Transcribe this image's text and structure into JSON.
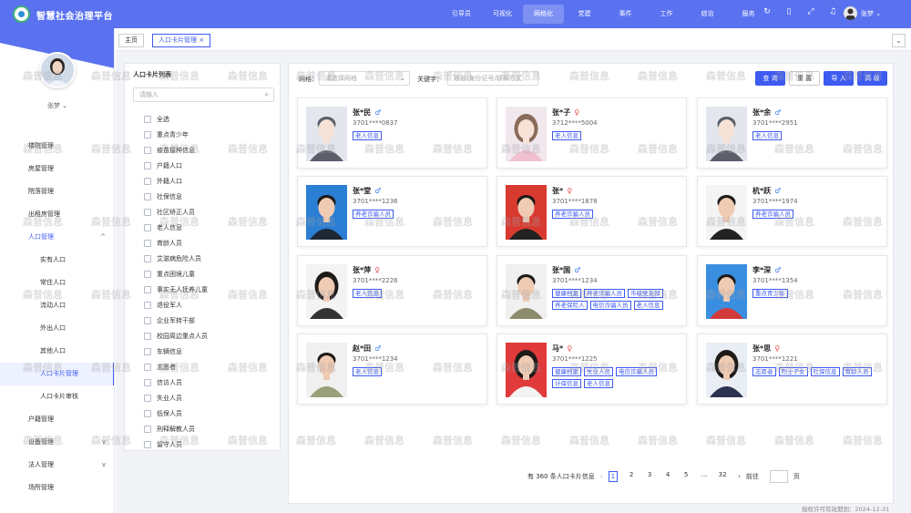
{
  "header": {
    "app_title": "智慧社会治理平台",
    "nav": [
      "引导员",
      "可视化",
      "网格化",
      "党建",
      "事件",
      "工作",
      "综治",
      "服务"
    ],
    "active_nav": "网格化",
    "user": "张梦"
  },
  "sidebar": {
    "user_name": "张梦",
    "items": [
      {
        "label": "楼院管理",
        "sub": false,
        "arrow": ""
      },
      {
        "label": "房屋管理",
        "sub": false,
        "arrow": ""
      },
      {
        "label": "院落管理",
        "sub": false,
        "arrow": ""
      },
      {
        "label": "出租房管理",
        "sub": false,
        "arrow": ""
      },
      {
        "label": "人口管理",
        "sub": false,
        "arrow": "^",
        "blue": true
      },
      {
        "label": "实有人口",
        "sub": true,
        "arrow": ""
      },
      {
        "label": "常住人口",
        "sub": true,
        "arrow": ""
      },
      {
        "label": "流动人口",
        "sub": true,
        "arrow": ""
      },
      {
        "label": "外出人口",
        "sub": true,
        "arrow": ""
      },
      {
        "label": "其他人口",
        "sub": true,
        "arrow": ""
      },
      {
        "label": "人口卡片管理",
        "sub": true,
        "arrow": "",
        "active": true
      },
      {
        "label": "人口卡片审核",
        "sub": true,
        "arrow": ""
      },
      {
        "label": "户籍管理",
        "sub": false,
        "arrow": ""
      },
      {
        "label": "设备管理",
        "sub": false,
        "arrow": "v"
      },
      {
        "label": "法人管理",
        "sub": false,
        "arrow": "v"
      },
      {
        "label": "场所管理",
        "sub": false,
        "arrow": ""
      }
    ]
  },
  "tabs": {
    "home": "主页",
    "current": "人口卡片管理"
  },
  "list_panel": {
    "title": "人口卡片列表",
    "search_placeholder": "请输入",
    "items": [
      "全选",
      "重点青少年",
      "疫苗接种信息",
      "户籍人口",
      "外籍人口",
      "社保信息",
      "社区矫正人员",
      "老人信息",
      "育龄人员",
      "艾滋病危险人员",
      "重点困境儿童",
      "事实无人抚养儿童",
      "退役军人",
      "企业军转干部",
      "校园周边重点人员",
      "车辆信息",
      "志愿者",
      "信访人员",
      "失业人员",
      "低保人员",
      "刑释解教人员",
      "留守人员"
    ]
  },
  "filter": {
    "grid_label": "网格：",
    "grid_placeholder": "请选择网格",
    "keyword_label": "关键字：",
    "keyword_placeholder": "姓名/身份证号/联系方式",
    "query": "查 询",
    "reset": "重 置",
    "import": "导 入",
    "advanced": "高 级"
  },
  "cards": [
    {
      "name": "张*民",
      "sex": "m",
      "id": "3701****0837",
      "tags": [
        "老人信息"
      ],
      "photo": "placeholder-male"
    },
    {
      "name": "张*子",
      "sex": "f",
      "id": "3712****5004",
      "tags": [
        "老人信息"
      ],
      "photo": "placeholder-female"
    },
    {
      "name": "张*余",
      "sex": "m",
      "id": "3701****2951",
      "tags": [
        "老人信息"
      ],
      "photo": "placeholder-male"
    },
    {
      "name": "张*堂",
      "sex": "m",
      "id": "3701****1236",
      "tags": [
        "养老诈骗人员"
      ],
      "photo": "man-blue"
    },
    {
      "name": "张*",
      "sex": "f",
      "id": "3701****1878",
      "tags": [
        "养老诈骗人员"
      ],
      "photo": "man-red"
    },
    {
      "name": "杭*跃",
      "sex": "m",
      "id": "3701****1974",
      "tags": [
        "养老诈骗人员"
      ],
      "photo": "man-white"
    },
    {
      "name": "张*萍",
      "sex": "f",
      "id": "3701****2226",
      "tags": [
        "老人信息"
      ],
      "photo": "woman-white"
    },
    {
      "name": "张*国",
      "sex": "m",
      "id": "3701****1234",
      "tags": [
        "健康档案",
        "养老诈骗人员",
        "市级党支部",
        "养老保险人",
        "电信诈骗人员",
        "老人信息"
      ],
      "photo": "old-man"
    },
    {
      "name": "李*深",
      "sex": "m",
      "id": "3701****1354",
      "tags": [
        "重点青少年"
      ],
      "photo": "boy-blue"
    },
    {
      "name": "赵*田",
      "sex": "m",
      "id": "3701****1234",
      "tags": [
        "老人信息"
      ],
      "photo": "old-man2"
    },
    {
      "name": "马*",
      "sex": "f",
      "id": "3701****1225",
      "tags": [
        "健康档案",
        "失业人员",
        "电信诈骗人员",
        "计保信息",
        "老人信息"
      ],
      "photo": "woman-red"
    },
    {
      "name": "张*思",
      "sex": "f",
      "id": "3701****1221",
      "tags": [
        "志愿者",
        "烈士子女",
        "社保信息",
        "育龄人员"
      ],
      "photo": "girl-blue"
    }
  ],
  "pagination": {
    "total": "有 360 条人口卡片信息",
    "pages": [
      "1",
      "2",
      "3",
      "4",
      "5",
      "…",
      "32"
    ],
    "current": "1",
    "goto_label": "前往",
    "page_unit": "页"
  },
  "footer": "授权许可有效期到：2024-12-31",
  "watermark": "森普信息"
}
